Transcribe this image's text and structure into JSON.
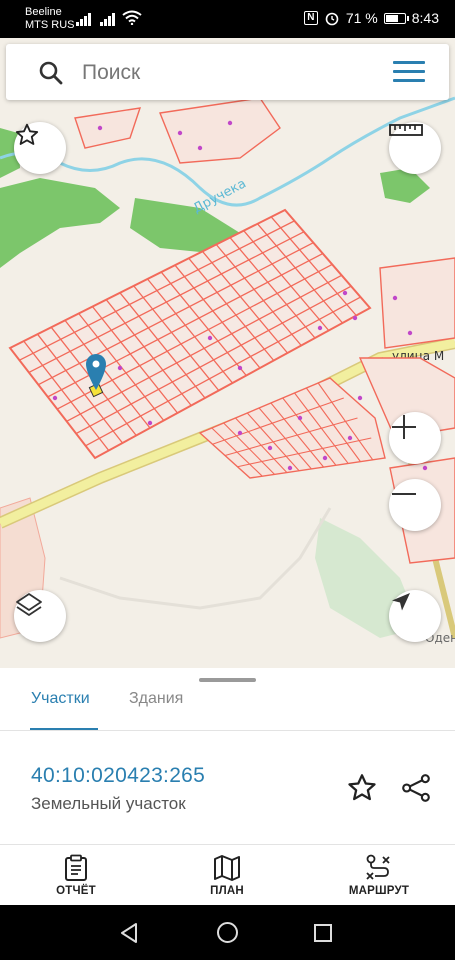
{
  "status_bar": {
    "carrier_line1": "Beeline",
    "carrier_line2": "MTS RUS",
    "nfc_label": "N",
    "battery_percent": "71 %",
    "battery_level": 0.71,
    "time": "8:43"
  },
  "search": {
    "placeholder": "Поиск"
  },
  "map": {
    "river_label": "Дручека",
    "street_label": "улица М",
    "edge_label": "Оден"
  },
  "tabs": [
    {
      "label": "Участки",
      "active": true
    },
    {
      "label": "Здания",
      "active": false
    }
  ],
  "parcel": {
    "cadastral_number": "40:10:020423:265",
    "type": "Земельный участок"
  },
  "bottom_nav": [
    {
      "label": "ОТЧЁТ",
      "icon": "report-icon"
    },
    {
      "label": "ПЛАН",
      "icon": "map-plan-icon"
    },
    {
      "label": "МАРШРУТ",
      "icon": "route-icon"
    }
  ],
  "colors": {
    "accent": "#2a7fb0",
    "parcel_outline": "#f26a5a",
    "forest": "#7cc66b",
    "road": "#f2ef9f",
    "river": "#8ed3e6",
    "marker": "#2a7fb0"
  }
}
